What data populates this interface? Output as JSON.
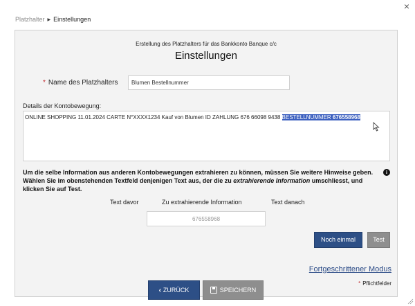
{
  "breadcrumb": {
    "parent": "Platzhalter",
    "current": "Einstellungen"
  },
  "dialog": {
    "subtitle": "Erstellung des Platzhalters für das Bankkonto Banque c/c",
    "title": "Einstellungen"
  },
  "name_field": {
    "label": "Name des Platzhalters",
    "value": "Blumen Bestellnummer"
  },
  "details": {
    "label": "Details der Kontobewegung:",
    "text_plain": "ONLINE SHOPPING 11.01.2024 CARTE N°XXXX1234 Kauf von Blumen ID ZAHLUNG 676 66098 9438 ",
    "text_selected": "BESTELLNUMMER ",
    "text_selected_bold": "676558968"
  },
  "hint": {
    "part1": "Um die selbe Information aus anderen Kontobewegungen extrahieren zu können, müssen Sie weitere Hinweise geben. Wählen Sie im obenstehenden Textfeld denjenigen Text aus, der die zu ",
    "italic": "extrahierende Information",
    "part2": " umschliesst, und klicken Sie auf Test."
  },
  "columns": {
    "before": "Text davor",
    "extract": "Zu extrahierende Information",
    "after": "Text danach"
  },
  "extract_value": "676558968",
  "buttons": {
    "again": "Noch einmal",
    "test": "Test",
    "back": "ZURÜCK",
    "save": "SPEICHERN"
  },
  "advanced_link": "Fortgeschrittener Modus",
  "required_note": "Pflichtfelder",
  "icons": {
    "close": "close-icon",
    "info": "info-icon",
    "back": "chevron-left-icon",
    "save": "floppy-disk-icon"
  }
}
